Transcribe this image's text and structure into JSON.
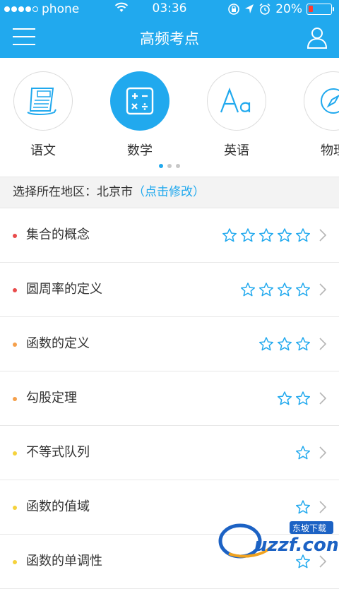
{
  "status": {
    "carrier": "phone",
    "time": "03:36",
    "battery_text": "20%",
    "battery_level": 0.2
  },
  "nav": {
    "title": "高频考点"
  },
  "categories": [
    {
      "label": "语文",
      "icon": "composition-icon",
      "active": false
    },
    {
      "label": "数学",
      "icon": "calculator-icon",
      "active": true
    },
    {
      "label": "英语",
      "icon": "letters-icon",
      "active": false
    },
    {
      "label": "物理",
      "icon": "compass-icon",
      "active": false
    }
  ],
  "pager": {
    "pages": 3,
    "current": 1
  },
  "region": {
    "prefix": "选择所在地区：北京市",
    "action": "（点击修改）"
  },
  "topics": [
    {
      "name": "集合的概念",
      "stars": 5,
      "bullet_color": "#e94b4b"
    },
    {
      "name": "圆周率的定义",
      "stars": 4,
      "bullet_color": "#e94b4b"
    },
    {
      "name": "函数的定义",
      "stars": 3,
      "bullet_color": "#f5a04b"
    },
    {
      "name": "勾股定理",
      "stars": 2,
      "bullet_color": "#f5a04b"
    },
    {
      "name": "不等式队列",
      "stars": 1,
      "bullet_color": "#f5d23c"
    },
    {
      "name": "函数的值域",
      "stars": 1,
      "bullet_color": "#f5d23c"
    },
    {
      "name": "函数的单调性",
      "stars": 1,
      "bullet_color": "#f5d23c"
    }
  ],
  "watermark": {
    "site": "uzzf.com",
    "cn": "东坡下载"
  },
  "colors": {
    "accent": "#21a9ee",
    "star": "#21a9ee"
  }
}
